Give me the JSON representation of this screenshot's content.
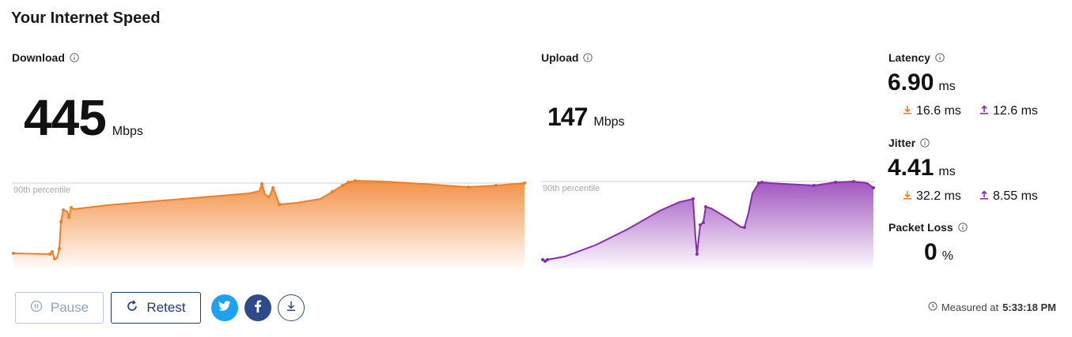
{
  "title": "Your Internet Speed",
  "download": {
    "label": "Download",
    "value": "445",
    "unit": "Mbps",
    "percentile_label": "90th percentile",
    "color": "#f07e26"
  },
  "upload": {
    "label": "Upload",
    "value": "147",
    "unit": "Mbps",
    "percentile_label": "90th percentile",
    "color": "#8a2bb0"
  },
  "latency": {
    "label": "Latency",
    "value": "6.90",
    "unit": "ms",
    "down": "16.6 ms",
    "up": "12.6 ms"
  },
  "jitter": {
    "label": "Jitter",
    "value": "4.41",
    "unit": "ms",
    "down": "32.2 ms",
    "up": "8.55 ms"
  },
  "packet_loss": {
    "label": "Packet Loss",
    "value": "0",
    "unit": "%"
  },
  "buttons": {
    "pause": "Pause",
    "retest": "Retest"
  },
  "icons": {
    "twitter": "twitter-icon",
    "facebook": "facebook-icon",
    "download": "download-icon",
    "info": "info-icon",
    "clock": "clock-icon"
  },
  "measured": {
    "prefix": "Measured at",
    "time": "5:33:18 PM"
  }
}
